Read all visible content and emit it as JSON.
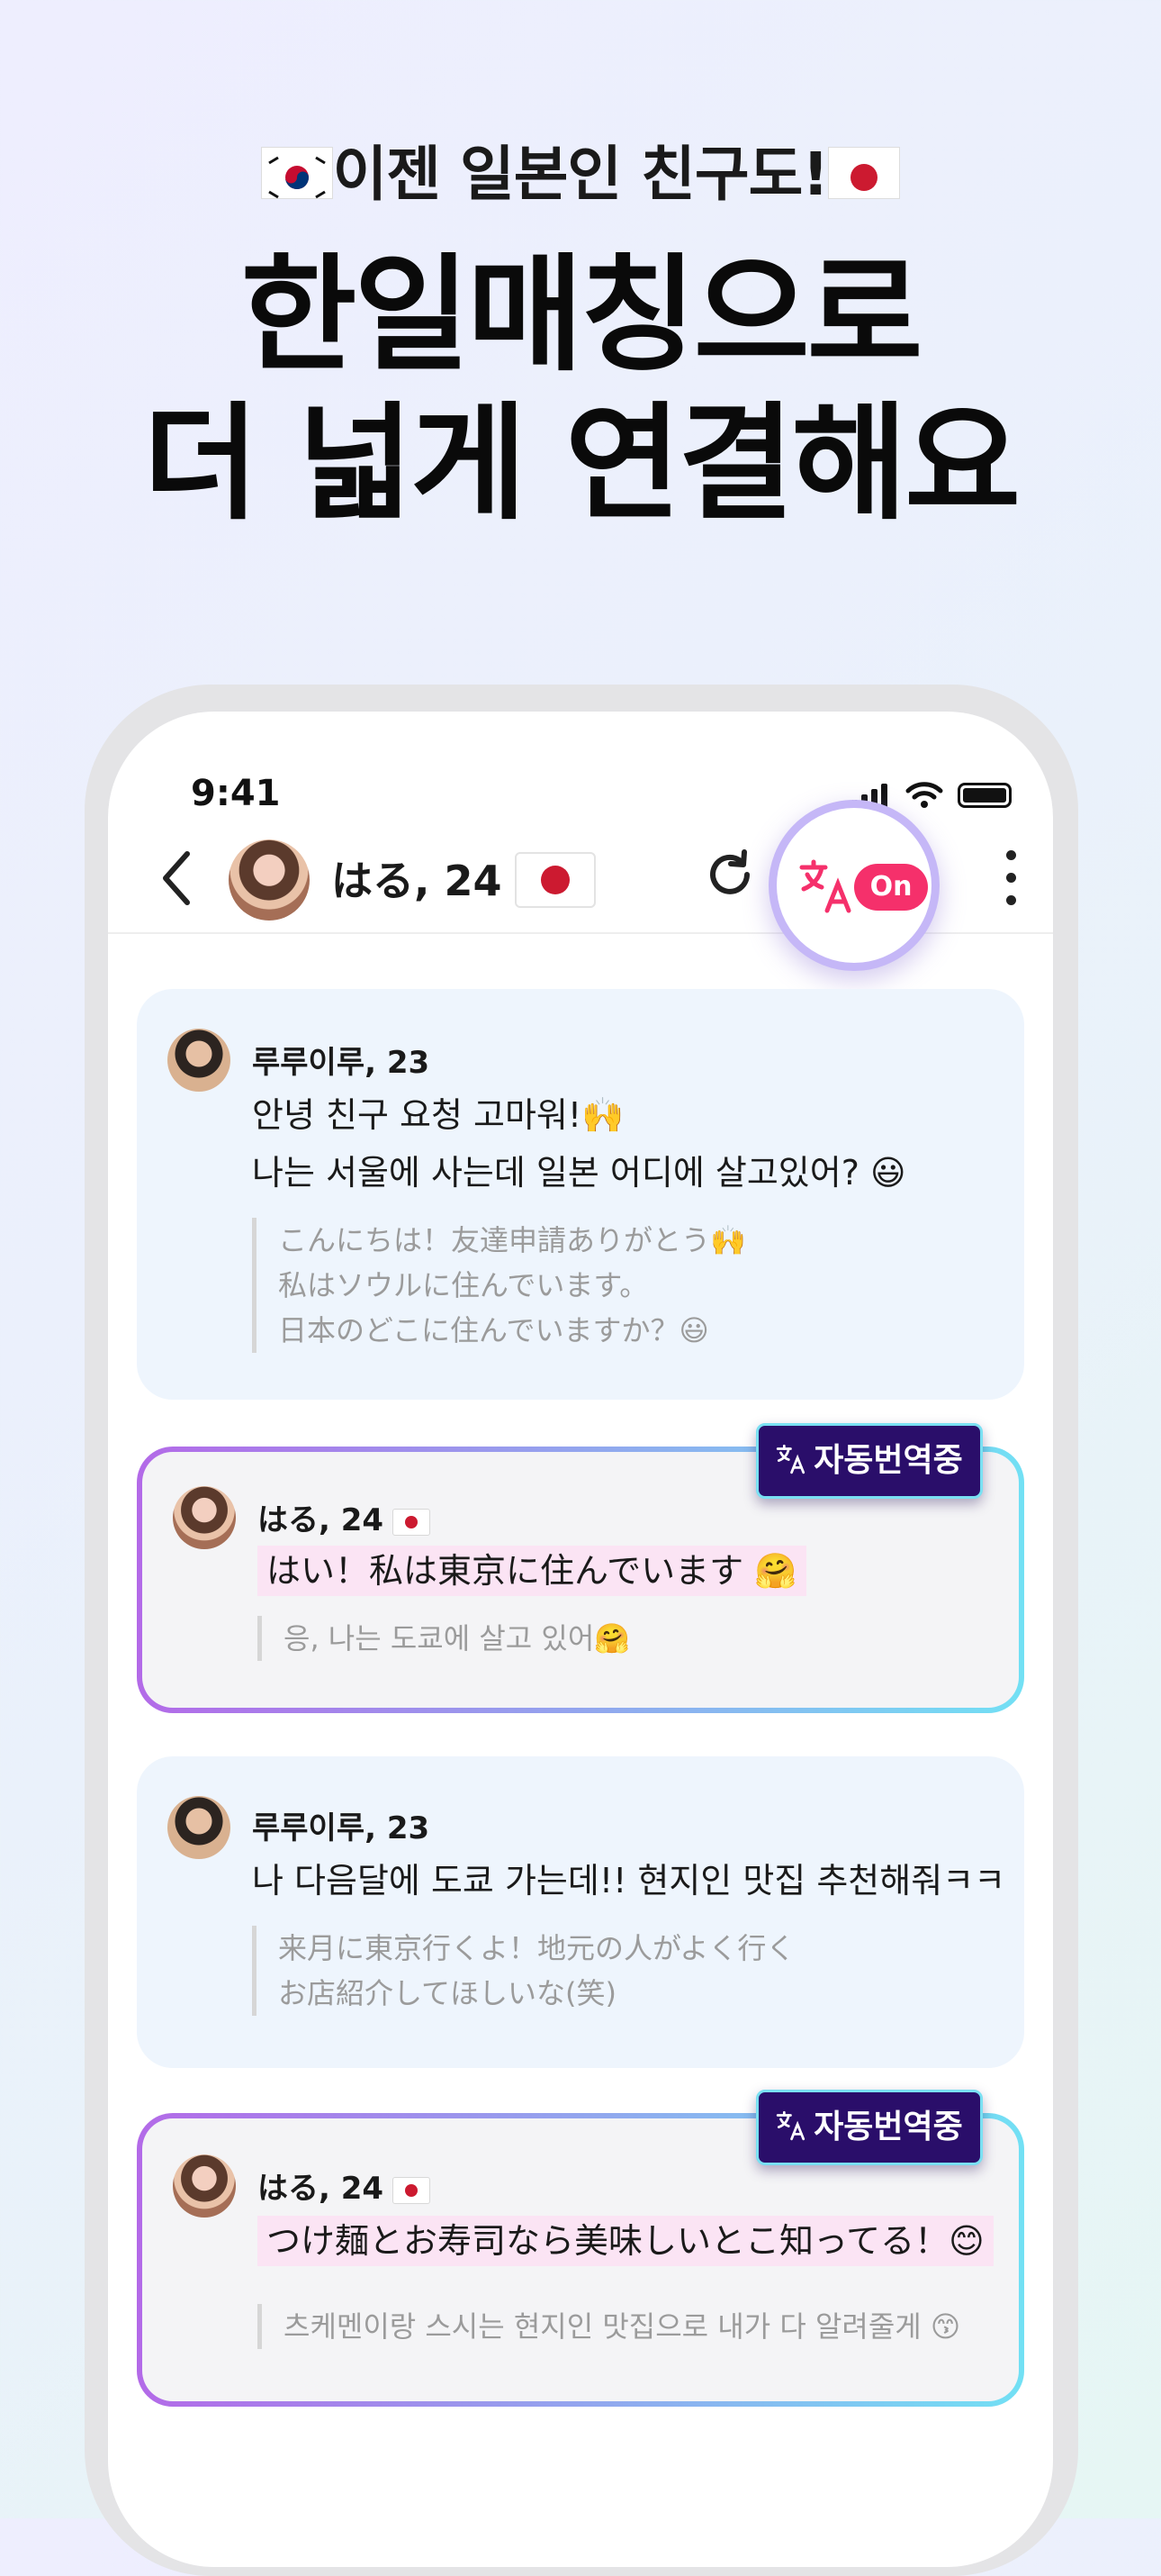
{
  "promo": {
    "subtitle": "이젠 일본인 친구도!",
    "headline_line1": "한일매칭으로",
    "headline_line2": "더 넓게 연결해요"
  },
  "status_bar": {
    "time": "9:41"
  },
  "chat_header": {
    "partner_name": "はる, 24",
    "translate_toggle": "On"
  },
  "messages": [
    {
      "sender": "루루이루, 23",
      "lines": [
        "안녕 친구 요청 고마워!🙌",
        "나는 서울에 사는데 일본 어디에 살고있어? 😃"
      ],
      "translation": [
        "こんにちは！友達申請ありがとう🙌",
        "私はソウルに住んでいます。",
        "日本のどこに住んでいますか？😃"
      ]
    },
    {
      "sender": "はる, 24",
      "badge": "자동번역중",
      "lines": [
        "はい！私は東京に住んでいます 🤗"
      ],
      "translation": [
        "응, 나는 도쿄에 살고 있어🤗"
      ]
    },
    {
      "sender": "루루이루, 23",
      "lines": [
        "나 다음달에 도쿄 가는데!! 현지인 맛집 추천해줘ㅋㅋ"
      ],
      "translation": [
        "来月に東京行くよ！地元の人がよく行く",
        "お店紹介してほしいな(笑)"
      ]
    },
    {
      "sender": "はる, 24",
      "badge": "자동번역중",
      "lines": [
        "つけ麺とお寿司なら美味しいとこ知ってる！😊"
      ],
      "translation": [
        "츠케멘이랑 스시는 현지인 맛집으로 내가 다 알려줄게 😙"
      ]
    }
  ],
  "colors": {
    "toggle_on": "#f5306b",
    "badge_bg": "#2a0e6a",
    "gradient_start": "#b36ae8",
    "gradient_end": "#72e0f4"
  }
}
